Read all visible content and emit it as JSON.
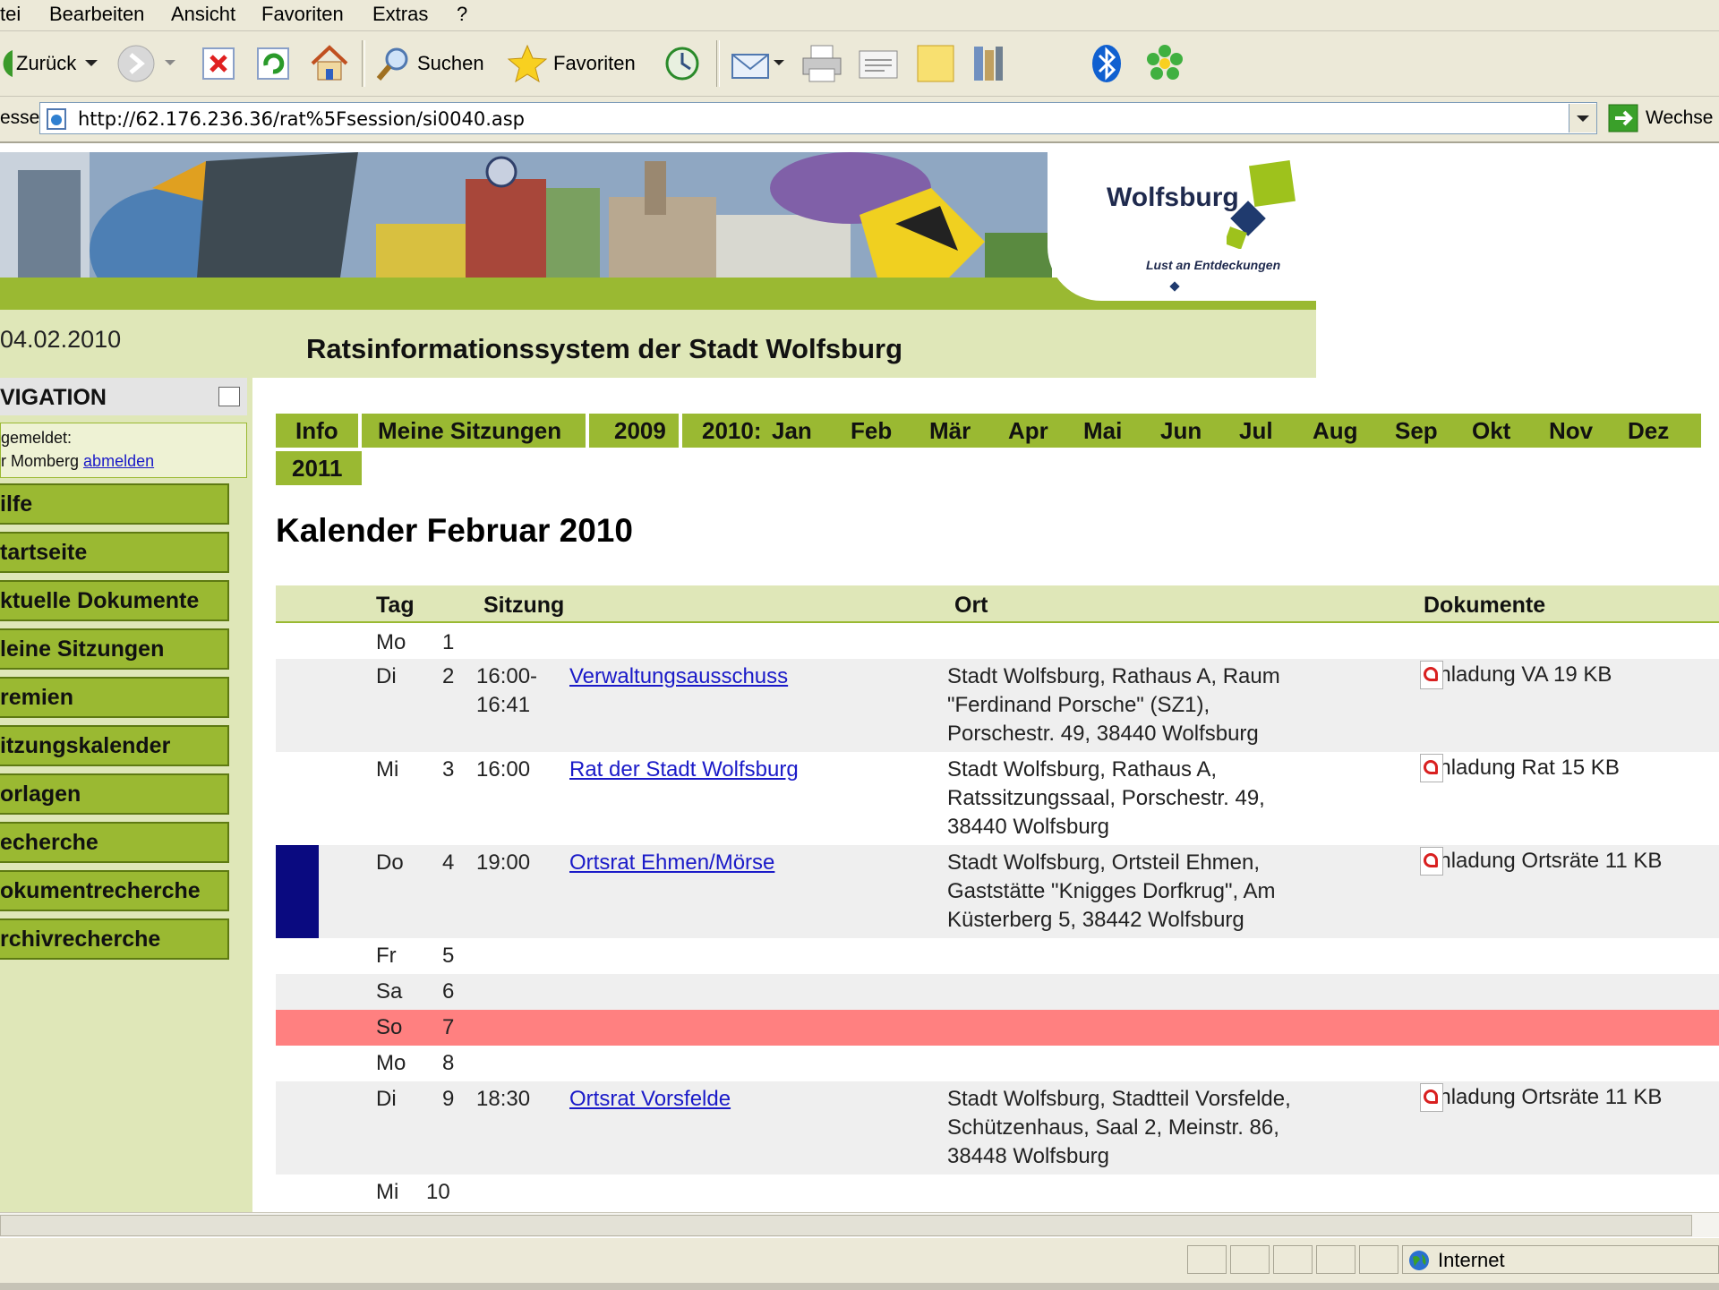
{
  "menu": {
    "items": [
      "tei",
      "Bearbeiten",
      "Ansicht",
      "Favoriten",
      "Extras",
      "?"
    ]
  },
  "toolbar": {
    "back_label": "Zurück",
    "search_label": "Suchen",
    "favorites_label": "Favoriten"
  },
  "address": {
    "label": "esse",
    "url": "http://62.176.236.36/rat%5Fsession/si0040.asp",
    "go_label": "Wechse"
  },
  "header": {
    "logo_text": "Wolfsburg",
    "logo_tagline": "Lust an Entdeckungen",
    "date": "04.02.2010",
    "site_title": "Ratsinformationssystem der Stadt Wolfsburg"
  },
  "sidebar": {
    "nav_title": "VIGATION",
    "login_line1": "gemeldet:",
    "login_user": "r Momberg",
    "logout_link": "abmelden",
    "items": [
      {
        "label": "ilfe"
      },
      {
        "label": "tartseite"
      },
      {
        "label": "ktuelle Dokumente"
      },
      {
        "label": "leine Sitzungen"
      },
      {
        "label": "remien"
      },
      {
        "label": "itzungskalender"
      },
      {
        "label": "orlagen"
      },
      {
        "label": "echerche"
      },
      {
        "label": "okumentrecherche"
      },
      {
        "label": "rchivrecherche"
      }
    ]
  },
  "tabs": {
    "info": "Info",
    "meine": "Meine Sitzungen",
    "y2009": "2009",
    "y2010": "2010:",
    "months": [
      "Jan",
      "Feb",
      "Mär",
      "Apr",
      "Mai",
      "Jun",
      "Jul",
      "Aug",
      "Sep",
      "Okt",
      "Nov",
      "Dez"
    ],
    "y2011": "2011"
  },
  "calendar": {
    "heading": "Kalender Februar 2010",
    "headers": {
      "tag": "Tag",
      "sitzung": "Sitzung",
      "ort": "Ort",
      "dokumente": "Dokumente"
    },
    "rows": [
      {
        "day": "Mo",
        "num": "1"
      },
      {
        "day": "Di",
        "num": "2",
        "time1": "16:00-",
        "time2": "16:41",
        "meeting": "Verwaltungsausschuss",
        "place": [
          "Stadt Wolfsburg, Rathaus A, Raum",
          "\"Ferdinand Porsche\" (SZ1),",
          "Porschestr. 49, 38440 Wolfsburg"
        ],
        "doc": "Einladung VA 19 KB"
      },
      {
        "day": "Mi",
        "num": "3",
        "time1": "16:00",
        "meeting": "Rat der Stadt Wolfsburg",
        "place": [
          "Stadt Wolfsburg, Rathaus A,",
          "Ratssitzungssaal, Porschestr. 49,",
          "38440 Wolfsburg"
        ],
        "doc": "Einladung Rat 15 KB"
      },
      {
        "day": "Do",
        "num": "4",
        "time1": "19:00",
        "meeting": "Ortsrat Ehmen/Mörse",
        "place": [
          "Stadt Wolfsburg, Ortsteil Ehmen,",
          "Gaststätte \"Knigges Dorfkrug\", Am",
          "Küsterberg 5, 38442 Wolfsburg"
        ],
        "doc": "Einladung Ortsräte 11 KB"
      },
      {
        "day": "Fr",
        "num": "5"
      },
      {
        "day": "Sa",
        "num": "6"
      },
      {
        "day": "So",
        "num": "7"
      },
      {
        "day": "Mo",
        "num": "8"
      },
      {
        "day": "Di",
        "num": "9",
        "time1": "18:30",
        "meeting": "Ortsrat Vorsfelde",
        "place": [
          "Stadt Wolfsburg, Stadtteil Vorsfelde,",
          "Schützenhaus, Saal 2, Meinstr. 86,",
          "38448 Wolfsburg"
        ],
        "doc": "Einladung Ortsräte 11 KB"
      },
      {
        "day": "Mi",
        "num": "10"
      }
    ]
  },
  "status": {
    "zone": "Internet"
  },
  "colors": {
    "green": "#9ab932",
    "light_green": "#dfe7b8",
    "sunday": "#ff8080",
    "today_marker": "#0a0a80"
  }
}
